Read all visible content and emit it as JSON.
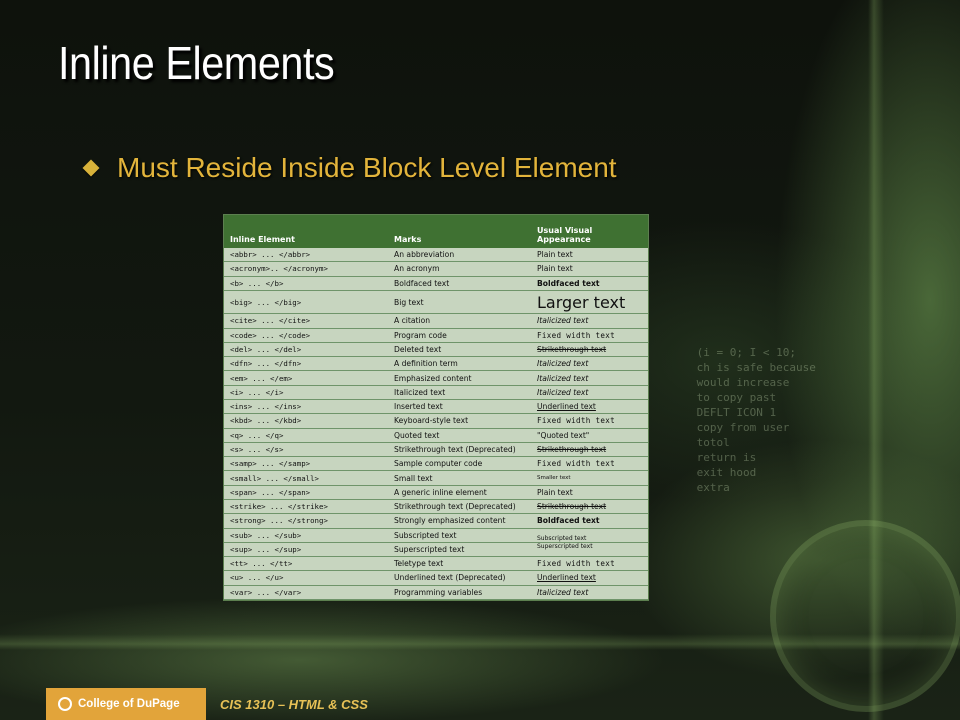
{
  "slide": {
    "title": "Inline Elements",
    "bullet": "Must Reside Inside Block Level Element"
  },
  "table": {
    "headers": [
      "Inline Element",
      "Marks",
      "Usual Visual Appearance"
    ],
    "rows": [
      {
        "element": "<abbr> ... </abbr>",
        "marks": "An abbreviation",
        "appearance": "Plain text",
        "style": "plain"
      },
      {
        "element": "<acronym>.. </acronym>",
        "marks": "An acronym",
        "appearance": "Plain text",
        "style": "plain"
      },
      {
        "element": "<b> ... </b>",
        "marks": "Boldfaced text",
        "appearance": "Boldfaced text",
        "style": "bold"
      },
      {
        "element": "<big> ... </big>",
        "marks": "Big text",
        "appearance": "Larger text",
        "style": "big"
      },
      {
        "element": "<cite> ... </cite>",
        "marks": "A citation",
        "appearance": "Italicized text",
        "style": "italic"
      },
      {
        "element": "<code> ... </code>",
        "marks": "Program code",
        "appearance": "Fixed width text",
        "style": "mono"
      },
      {
        "element": "<del> ... </del>",
        "marks": "Deleted text",
        "appearance": "Strikethrough text",
        "style": "strike"
      },
      {
        "element": "<dfn> ... </dfn>",
        "marks": "A definition term",
        "appearance": "Italicized text",
        "style": "italic"
      },
      {
        "element": "<em> ... </em>",
        "marks": "Emphasized content",
        "appearance": "Italicized text",
        "style": "italic"
      },
      {
        "element": "<i> ... </i>",
        "marks": "Italicized text",
        "appearance": "Italicized text",
        "style": "italic"
      },
      {
        "element": "<ins> ... </ins>",
        "marks": "Inserted text",
        "appearance": "Underlined text",
        "style": "underline"
      },
      {
        "element": "<kbd> ... </kbd>",
        "marks": "Keyboard-style text",
        "appearance": "Fixed width text",
        "style": "mono"
      },
      {
        "element": "<q> ... </q>",
        "marks": "Quoted text",
        "appearance": "\"Quoted text\"",
        "style": "plain"
      },
      {
        "element": "<s> ... </s>",
        "marks": "Strikethrough text (Deprecated)",
        "appearance": "Strikethrough text",
        "style": "strike"
      },
      {
        "element": "<samp> ... </samp>",
        "marks": "Sample computer code",
        "appearance": "Fixed width text",
        "style": "mono"
      },
      {
        "element": "<small> ... </small>",
        "marks": "Small text",
        "appearance": "Smaller text",
        "style": "small"
      },
      {
        "element": "<span> ... </span>",
        "marks": "A generic inline element",
        "appearance": "Plain text",
        "style": "plain"
      },
      {
        "element": "<strike> ... </strike>",
        "marks": "Strikethrough text (Deprecated)",
        "appearance": "Strikethrough text",
        "style": "strike"
      },
      {
        "element": "<strong> ... </strong>",
        "marks": "Strongly emphasized content",
        "appearance": "Boldfaced text",
        "style": "bold"
      },
      {
        "element": "<sub> ... </sub>",
        "marks": "Subscripted text",
        "appearance": "Subscripted text",
        "style": "sub"
      },
      {
        "element": "<sup> ... </sup>",
        "marks": "Superscripted text",
        "appearance": "Superscripted text",
        "style": "sup"
      },
      {
        "element": "<tt> ... </tt>",
        "marks": "Teletype text",
        "appearance": "Fixed width text",
        "style": "mono"
      },
      {
        "element": "<u> ... </u>",
        "marks": "Underlined text (Deprecated)",
        "appearance": "Underlined text",
        "style": "underline"
      },
      {
        "element": "<var> ... </var>",
        "marks": "Programming variables",
        "appearance": "Italicized text",
        "style": "italic"
      }
    ]
  },
  "footer": {
    "brand": "College of DuPage",
    "course": "CIS 1310 – HTML & CSS"
  }
}
